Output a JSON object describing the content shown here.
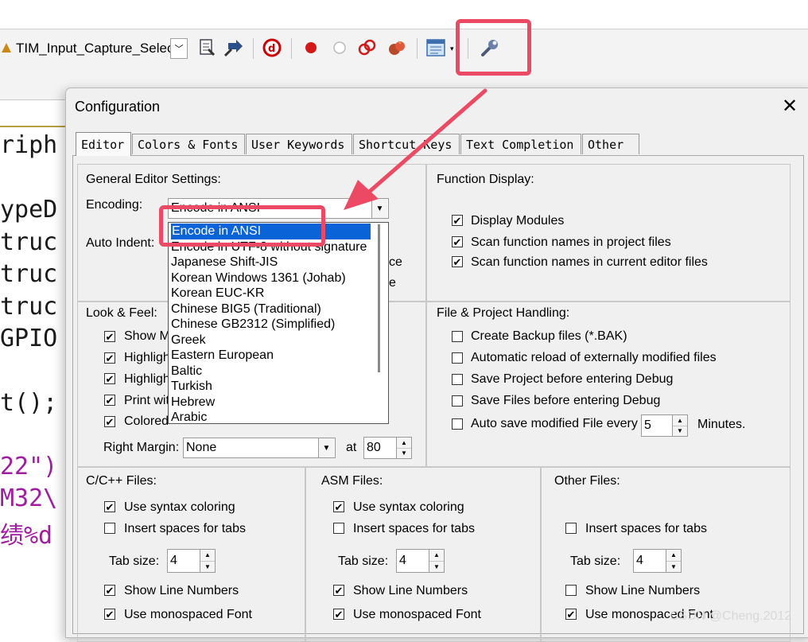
{
  "toolbar": {
    "target_combo": "TIM_Input_Capture_Selec",
    "icons": [
      "build-icon",
      "download-icon",
      "debug-icon",
      "breakpoint-icon",
      "breakpoint-disabled-icon",
      "kill-breakpoints-icon",
      "disable-breakpoints-icon",
      "window-layout-icon",
      "configuration-wrench-icon"
    ]
  },
  "editor_code": {
    "lines": [
      "riph",
      "",
      "ypeD",
      "truc",
      "truc",
      "truc",
      "GPIO",
      "",
      "t();",
      "",
      "22\")",
      "M32\\",
      "绩%d"
    ],
    "colors": {
      "normal": "#1a1a1a",
      "string": "#a01ca0"
    }
  },
  "dialog": {
    "title": "Configuration",
    "close": "✕",
    "tabs": [
      "Editor",
      "Colors & Fonts",
      "User Keywords",
      "Shortcut Keys",
      "Text Completion",
      "Other"
    ],
    "general": {
      "title": "General Editor Settings:",
      "encoding_label": "Encoding:",
      "encoding_value": "Encode in ANSI",
      "auto_indent_label": "Auto Indent:",
      "hidden_tail_1": "ce",
      "hidden_tail_2": "e"
    },
    "encoding_options": [
      "Encode in ANSI",
      "Encode in UTF-8 without signature",
      "Japanese Shift-JIS",
      "Korean Windows 1361 (Johab)",
      "Korean EUC-KR",
      "Chinese BIG5 (Traditional)",
      "Chinese GB2312 (Simplified)",
      "Greek",
      "Eastern European",
      "Baltic",
      "Turkish",
      "Hebrew",
      "Arabic"
    ],
    "function_display": {
      "title": "Function Display:",
      "items": [
        {
          "label": "Display Modules",
          "checked": true
        },
        {
          "label": "Scan function names in project files",
          "checked": true
        },
        {
          "label": "Scan function names in current editor files",
          "checked": true
        }
      ]
    },
    "look_feel": {
      "title": "Look & Feel:",
      "items": [
        {
          "label": "Show M",
          "checked": true
        },
        {
          "label": "Highligh",
          "checked": true
        },
        {
          "label": "Highligh",
          "checked": true
        },
        {
          "label": "Print wit",
          "checked": true
        },
        {
          "label": "Colored",
          "checked": true
        }
      ],
      "right_margin_label": "Right Margin:",
      "right_margin_value": "None",
      "at_label": "at",
      "at_value": "80"
    },
    "file_project": {
      "title": "File & Project Handling:",
      "items": [
        {
          "label": "Create Backup files (*.BAK)",
          "checked": false
        },
        {
          "label": "Automatic reload of externally modified files",
          "checked": false
        },
        {
          "label": "Save Project before entering Debug",
          "checked": false
        },
        {
          "label": "Save Files before entering Debug",
          "checked": false
        },
        {
          "label": "Auto save modified File every",
          "checked": false
        }
      ],
      "autosave_value": "5",
      "minutes_label": "Minutes."
    },
    "c_files": {
      "title": "C/C++ Files:",
      "syntax": "Use syntax coloring",
      "insert_spaces": "Insert spaces for tabs",
      "tab_size_label": "Tab size:",
      "tab_size": "4",
      "line_numbers": "Show Line Numbers",
      "monospaced": "Use monospaced Font"
    },
    "asm_files": {
      "title": "ASM Files:",
      "syntax": "Use syntax coloring",
      "insert_spaces": "Insert spaces for tabs",
      "tab_size_label": "Tab size:",
      "tab_size": "4",
      "line_numbers": "Show Line Numbers",
      "monospaced": "Use monospaced Font"
    },
    "other_files": {
      "title": "Other Files:",
      "insert_spaces": "Insert spaces for tabs",
      "tab_size_label": "Tab size:",
      "tab_size": "4",
      "line_numbers": "Show Line Numbers",
      "monospaced": "Use monospaced Font"
    }
  },
  "watermark": "CSDN @Cheng.2012",
  "annotation_color": "#ec4a64"
}
